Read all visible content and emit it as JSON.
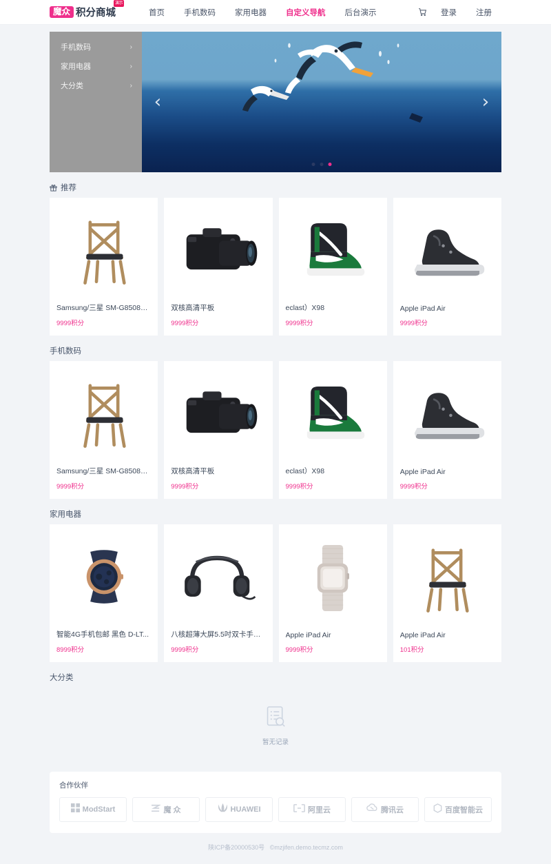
{
  "header": {
    "brand_badge": "魔众",
    "brand_name": "积分商城",
    "brand_sup": "演示",
    "nav": [
      {
        "label": "首页",
        "active": false
      },
      {
        "label": "手机数码",
        "active": false
      },
      {
        "label": "家用电器",
        "active": false
      },
      {
        "label": "自定义导航",
        "active": true
      },
      {
        "label": "后台演示",
        "active": false
      }
    ],
    "cart_icon": "cart-icon",
    "login": "登录",
    "register": "注册"
  },
  "hero": {
    "categories": [
      {
        "label": "手机数码",
        "chevron": "›"
      },
      {
        "label": "家用电器",
        "chevron": "›"
      },
      {
        "label": "大分类",
        "chevron": "›"
      }
    ],
    "arrow_left": "‹",
    "arrow_right": "›",
    "dots": 3,
    "active_dot": 3
  },
  "sections": [
    {
      "title": "推荐",
      "icon": "gift-icon",
      "items": [
        {
          "title": "Samsung/三星 SM-G8508S ...",
          "price": "9999积分",
          "image": "chair"
        },
        {
          "title": "双核高清平板",
          "price": "9999积分",
          "image": "camera"
        },
        {
          "title": "eclast）X98",
          "price": "9999积分",
          "image": "sneaker"
        },
        {
          "title": "Apple iPad Air",
          "price": "9999积分",
          "image": "boot"
        }
      ]
    },
    {
      "title": "手机数码",
      "icon": "",
      "items": [
        {
          "title": "Samsung/三星 SM-G8508S ...",
          "price": "9999积分",
          "image": "chair"
        },
        {
          "title": "双核高清平板",
          "price": "9999积分",
          "image": "camera"
        },
        {
          "title": "eclast）X98",
          "price": "9999积分",
          "image": "sneaker"
        },
        {
          "title": "Apple iPad Air",
          "price": "9999积分",
          "image": "boot"
        }
      ]
    },
    {
      "title": "家用电器",
      "icon": "",
      "items": [
        {
          "title": "智能4G手机包邮 黑色 D-LT...",
          "price": "8999积分",
          "image": "watch"
        },
        {
          "title": "八核超薄大屏5.5吋双卡手机...",
          "price": "9999积分",
          "image": "headphones"
        },
        {
          "title": "Apple iPad Air",
          "price": "9999积分",
          "image": "smartwatch"
        },
        {
          "title": "Apple iPad Air",
          "price": "101积分",
          "image": "chair"
        }
      ]
    }
  ],
  "empty_section": {
    "title": "大分类",
    "icon": "empty-records-icon",
    "text": "暂无记录"
  },
  "partners": {
    "title": "合作伙伴",
    "items": [
      {
        "name": "ModStart",
        "icon": "modstart-icon"
      },
      {
        "name": "魔 众",
        "icon": "mozhong-icon"
      },
      {
        "name": "HUAWEI",
        "icon": "huawei-icon"
      },
      {
        "name": "阿里云",
        "icon": "aliyun-icon"
      },
      {
        "name": "腾讯云",
        "icon": "tencentcloud-icon"
      },
      {
        "name": "百度智能云",
        "icon": "baiducloud-icon"
      }
    ]
  },
  "footer": {
    "icp": "陕ICP备20000530号",
    "copyright": "©mzjifen.demo.tecmz.com"
  },
  "colors": {
    "accent": "#ef2f8c",
    "text": "#3a4559",
    "bg": "#f2f4f7",
    "sidebar": "#9b9b9b"
  }
}
